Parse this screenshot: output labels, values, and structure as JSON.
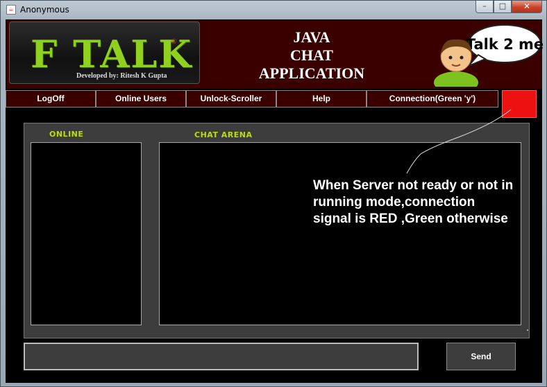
{
  "window": {
    "title": "Anonymous",
    "icon": "java-app-icon",
    "minimize": "–",
    "maximize": "□",
    "close": "✕"
  },
  "banner": {
    "logo": "F TALK",
    "logo_reg": "®",
    "credit": "Developed by: Ritesh K Gupta",
    "title_lines": [
      "JAVA",
      "CHAT",
      "APPLICATION"
    ],
    "mascot_bubble": "Talk 2 me"
  },
  "menu": {
    "items": [
      "LogOff",
      "Online Users",
      "Unlock-Scroller",
      "Help",
      "Connection(Green 'y')"
    ]
  },
  "connection": {
    "status": "red",
    "color": "#ee1111"
  },
  "panels": {
    "online_label": "ONLINE",
    "chat_label": "CHAT ARENA"
  },
  "annotation": {
    "text": "When Server not ready or not in running mode,connection signal is RED ,Green otherwise"
  },
  "input": {
    "value": "",
    "placeholder": ""
  },
  "send_label": "Send",
  "colors": {
    "banner_bg": "#3a0000",
    "logo": "#8fd11e",
    "label": "#b8e000",
    "panel": "#3d3d3d"
  }
}
